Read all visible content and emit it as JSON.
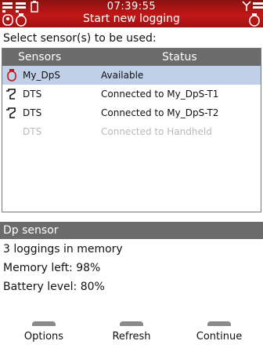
{
  "header": {
    "time": "07:39:55",
    "title": "Start new logging"
  },
  "prompt": "Select sensor(s) to be used:",
  "table": {
    "columns": [
      "Sensors",
      "Status"
    ],
    "rows": [
      {
        "icon": "pressure-sensor-icon",
        "name": "My_DpS",
        "status": "Available",
        "selected": true,
        "disabled": false
      },
      {
        "icon": "temperature-probe-icon",
        "name": "DTS",
        "status": "Connected to My_DpS-T1",
        "selected": false,
        "disabled": false
      },
      {
        "icon": "temperature-probe-icon",
        "name": "DTS",
        "status": "Connected to My_DpS-T2",
        "selected": false,
        "disabled": false
      },
      {
        "icon": "",
        "name": "DTS",
        "status": "Connected to Handheld",
        "selected": false,
        "disabled": true
      }
    ]
  },
  "info": {
    "title": "Dp sensor",
    "loggings": "3 loggings in memory",
    "memory": "Memory left: 98%",
    "battery": "Battery level: 80%"
  },
  "softkeys": {
    "left": "Options",
    "center": "Refresh",
    "right": "Continue"
  },
  "colors": {
    "header_red": "#c21717",
    "bar_gray": "#6b6b6b",
    "selection_blue": "#bfd0e8",
    "disabled_text": "#b9b9b9"
  }
}
